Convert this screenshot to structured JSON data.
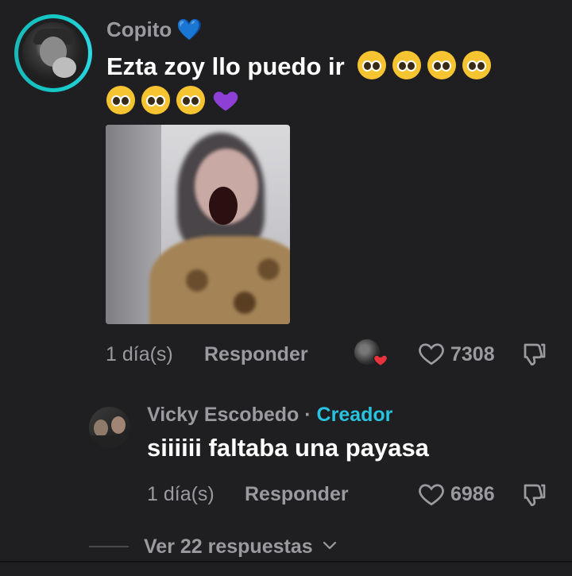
{
  "main_comment": {
    "username": "Copito",
    "text": "Ezta zoy llo puedo ir",
    "date": "1 día(s)",
    "reply_label": "Responder",
    "likes": "7308"
  },
  "reply_comment": {
    "username": "Vicky Escobedo",
    "separator": "·",
    "badge": "Creador",
    "text": "siiiiii faltaba una payasa",
    "date": "1 día(s)",
    "reply_label": "Responder",
    "likes": "6986"
  },
  "view_more": {
    "label": "Ver 22 respuestas"
  },
  "colors": {
    "background": "#1f1f21",
    "muted_text": "#9a9a9f",
    "creator_accent": "#27c3df",
    "avatar_ring": "#13c7c4",
    "blue_heart": "#1d6fd6",
    "purple_heart": "#8e3fd6",
    "red_heart": "#e8323e"
  },
  "icons": {
    "like": "heart-outline-icon",
    "dislike": "thumbs-down-icon",
    "expand": "chevron-down-icon"
  }
}
